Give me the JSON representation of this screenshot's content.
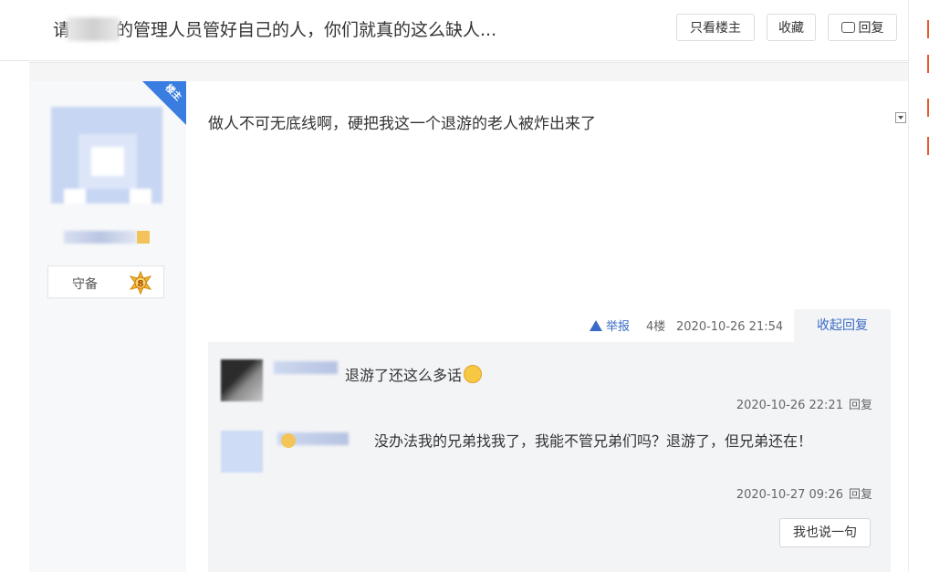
{
  "header": {
    "title_prefix": "请",
    "title_suffix": "的管理人员管好自己的人，你们就真的这么缺人...",
    "buttons": {
      "only_op": "只看楼主",
      "favorite": "收藏",
      "reply": "回复"
    }
  },
  "author": {
    "op_tag": "楼主",
    "level_label": "守备",
    "level_num": "8"
  },
  "post": {
    "content": "做人不可无底线啊，硬把我这一个退游的老人被炸出来了",
    "report": "举报",
    "floor": "4楼",
    "time": "2020-10-26 21:54",
    "collapse": "收起回复"
  },
  "comments": [
    {
      "text": "退游了还这么多话",
      "time": "2020-10-26 22:21",
      "reply": "回复"
    },
    {
      "text": "没办法我的兄弟找我了，我能不管兄弟们吗？退游了，但兄弟还在！",
      "time": "2020-10-27 09:26",
      "reply": "回复"
    }
  ],
  "say_button": "我也说一句",
  "colors": {
    "link": "#3a6bc4",
    "op_corner": "#3a7de0",
    "accent": "#e85a2a"
  }
}
